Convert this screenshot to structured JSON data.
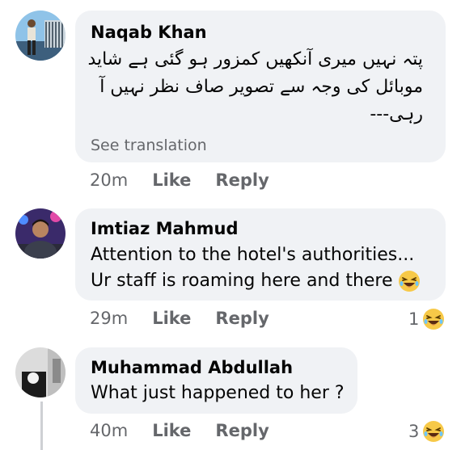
{
  "comments": [
    {
      "author": "Naqab Khan",
      "lines": [
        "پتہ نہیں میری آنکھیں کمزور ہو گئی ہے شاید",
        "موبائل کی وجہ سے تصویر صاف نظر نہیں آ",
        "رہی---"
      ],
      "see_translation": "See translation",
      "time": "20m",
      "like_label": "Like",
      "reply_label": "Reply"
    },
    {
      "author": "Imtiaz Mahmud",
      "lines": [
        "Attention to the hotel's authorities...",
        "Ur staff is roaming here and there"
      ],
      "time": "29m",
      "like_label": "Like",
      "reply_label": "Reply",
      "reaction_count": "1",
      "reaction_icon": "laughing-emoji"
    },
    {
      "author": "Muhammad Abdullah",
      "lines": [
        "What just happened to her ?"
      ],
      "time": "40m",
      "like_label": "Like",
      "reply_label": "Reply",
      "reaction_count": "3",
      "reaction_icon": "laughing-emoji"
    }
  ]
}
